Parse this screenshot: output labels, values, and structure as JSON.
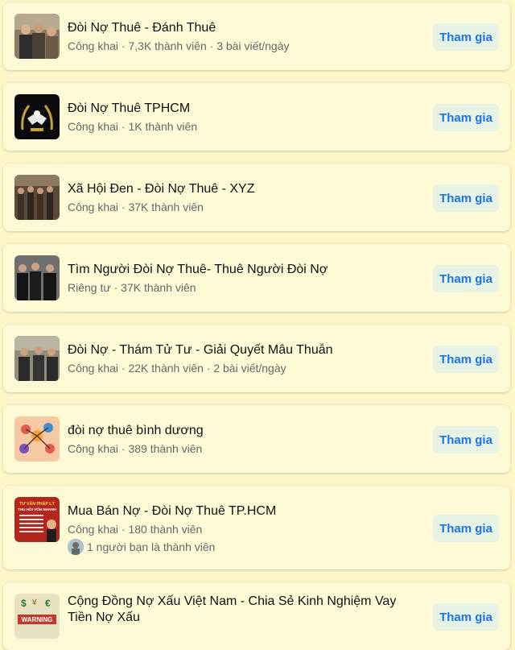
{
  "groups": [
    {
      "name": "Đòi Nợ Thuê - Đánh Thuê",
      "meta": "Công khai · 7,3K thành viên · 3 bài viết/ngày",
      "button": "Tham gia"
    },
    {
      "name": "Đòi Nợ Thuê TPHCM",
      "meta": "Công khai · 1K thành viên",
      "button": "Tham gia"
    },
    {
      "name": "Xã Hội Đen - Đòi Nợ Thuê - XYZ",
      "meta": "Công khai · 37K thành viên",
      "button": "Tham gia"
    },
    {
      "name": "Tìm Người Đòi Nợ Thuê- Thuê Người Đòi Nợ",
      "meta": "Riêng tư · 37K thành viên",
      "button": "Tham gia"
    },
    {
      "name": "Đòi Nợ - Thám Tử Tư - Giải Quyết Mâu Thuẫn",
      "meta": "Công khai · 22K thành viên · 2 bài viết/ngày",
      "button": "Tham gia"
    },
    {
      "name": "đòi nợ thuê bình dương",
      "meta": "Công khai · 389 thành viên",
      "button": "Tham gia"
    },
    {
      "name": "Mua Bán Nợ - Đòi Nợ Thuê TP.HCM",
      "meta": "Công khai · 180 thành viên",
      "friends": "1 người bạn là thành viên",
      "button": "Tham gia"
    },
    {
      "name": "Cộng Đồng Nợ Xấu Việt Nam - Chia Sẻ Kinh Nghiệm Vay Tiền Nợ Xấu",
      "button": "Tham gia"
    }
  ],
  "thumb_text": {
    "poster_line1": "TƯ VẤN PHÁP LÝ",
    "poster_line2": "THU HỒI VỐN NHANH",
    "warning": "WARNING"
  },
  "colors": {
    "background": "#fdf6c8",
    "card": "#fffad6",
    "button_bg": "#e7f3e4",
    "button_text": "#1b74e4"
  }
}
